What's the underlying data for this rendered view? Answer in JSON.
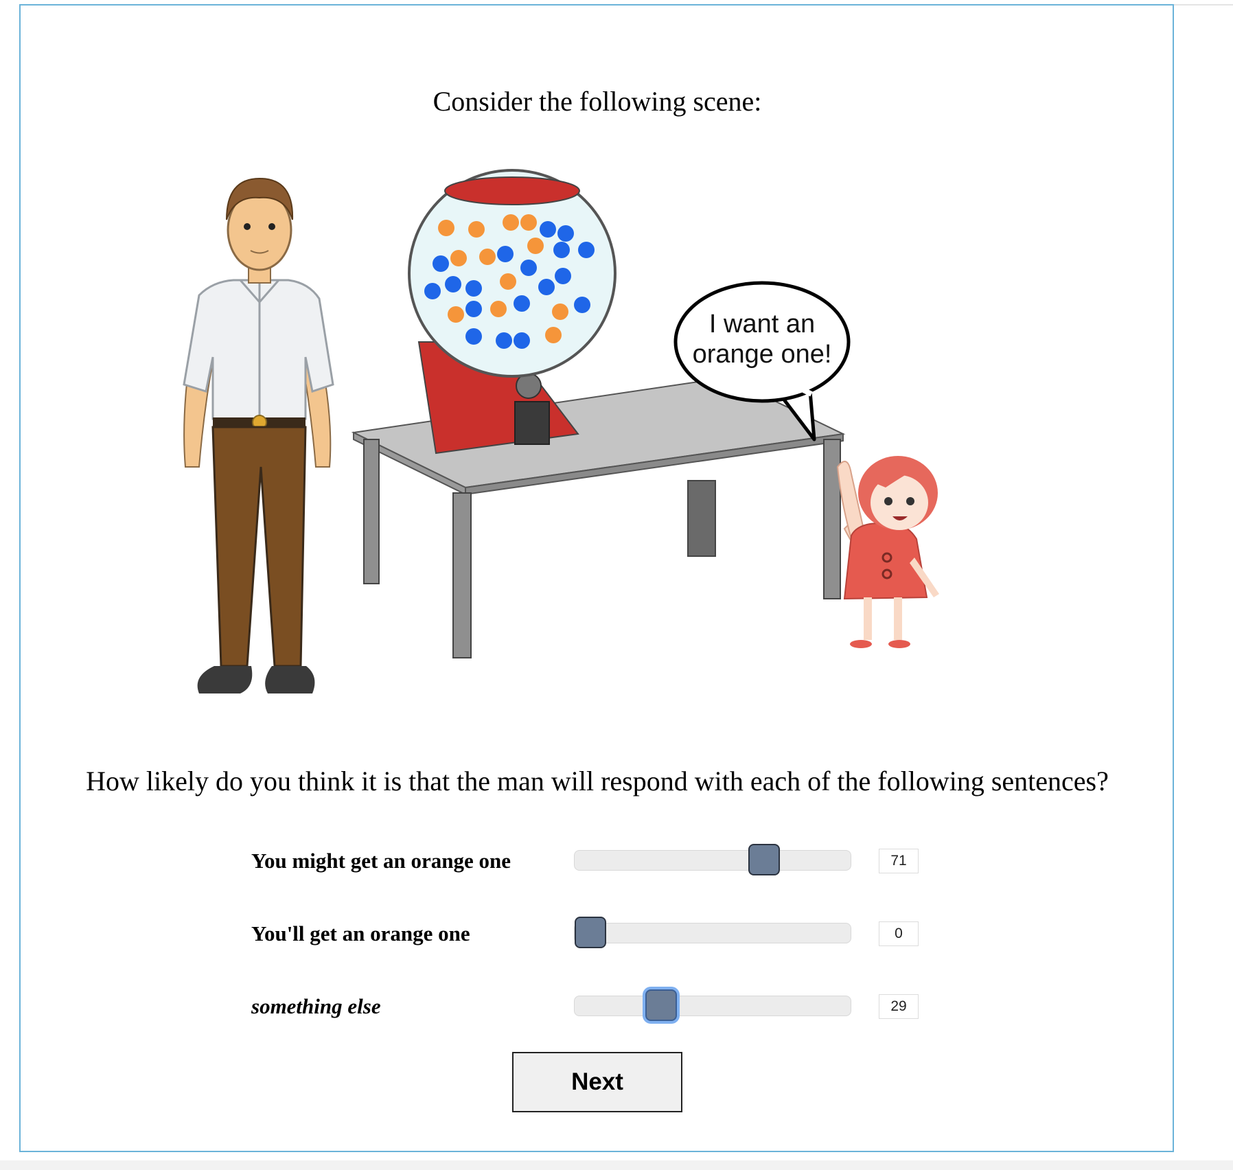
{
  "heading": "Consider the following scene:",
  "scene": {
    "speech_bubble_line1": "I want an",
    "speech_bubble_line2": "orange one!"
  },
  "question": "How likely do you think it is that the man will respond with each of the following sentences?",
  "responses": [
    {
      "label": "You might get an orange one",
      "value": "71",
      "level": 71
    },
    {
      "label": "You'll get an orange one",
      "value": "0",
      "level": 0
    },
    {
      "label": "something else",
      "value": "29",
      "level": 29
    }
  ],
  "next_button": "Next",
  "colors": {
    "frame_border": "#6bb3d9",
    "slider_thumb": "#6b7d96",
    "gumball_orange": "#f5953a",
    "gumball_blue": "#1f66e8",
    "machine_red": "#c9302c"
  }
}
